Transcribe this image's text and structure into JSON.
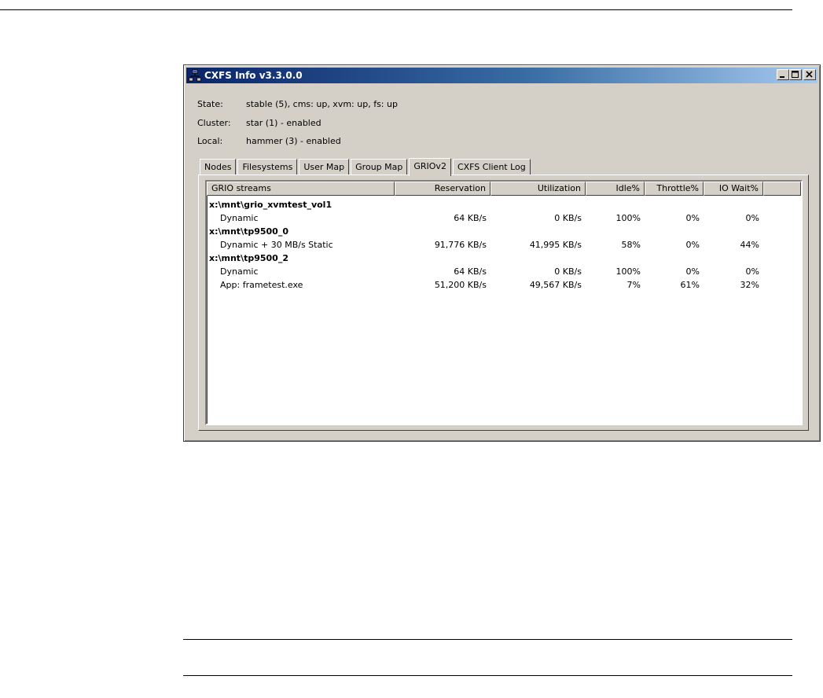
{
  "window": {
    "title": "CXFS Info v3.3.0.0"
  },
  "info": {
    "state_label": "State:",
    "state_value": "stable (5), cms: up, xvm: up, fs: up",
    "cluster_label": "Cluster:",
    "cluster_value": "star (1) - enabled",
    "local_label": "Local:",
    "local_value": "hammer (3) - enabled"
  },
  "tabs": [
    {
      "label": "Nodes"
    },
    {
      "label": "Filesystems"
    },
    {
      "label": "User Map"
    },
    {
      "label": "Group Map"
    },
    {
      "label": "GRIOv2",
      "active": true
    },
    {
      "label": "CXFS Client Log"
    }
  ],
  "table": {
    "columns": [
      "GRIO streams",
      "Reservation",
      "Utilization",
      "Idle%",
      "Throttle%",
      "IO Wait%"
    ],
    "rows": [
      {
        "type": "group",
        "name": "x:\\mnt\\grio_xvmtest_vol1"
      },
      {
        "type": "stream",
        "name": "Dynamic",
        "reservation": "64 KB/s",
        "utilization": "0 KB/s",
        "idle": "100%",
        "throttle": "0%",
        "iowait": "0%"
      },
      {
        "type": "group",
        "name": "x:\\mnt\\tp9500_0"
      },
      {
        "type": "stream",
        "name": "Dynamic + 30 MB/s Static",
        "reservation": "91,776 KB/s",
        "utilization": "41,995 KB/s",
        "idle": "58%",
        "throttle": "0%",
        "iowait": "44%"
      },
      {
        "type": "group",
        "name": "x:\\mnt\\tp9500_2"
      },
      {
        "type": "stream",
        "name": "Dynamic",
        "reservation": "64 KB/s",
        "utilization": "0 KB/s",
        "idle": "100%",
        "throttle": "0%",
        "iowait": "0%"
      },
      {
        "type": "stream",
        "name": "App: frametest.exe",
        "reservation": "51,200 KB/s",
        "utilization": "49,567 KB/s",
        "idle": "7%",
        "throttle": "61%",
        "iowait": "32%"
      }
    ]
  },
  "icons": {
    "app": "network-nodes-icon",
    "minimize": "minimize-icon",
    "maximize": "maximize-icon",
    "close": "close-icon"
  },
  "colors": {
    "titlebar_start": "#0a246a",
    "titlebar_end": "#a6caf0",
    "window_face": "#d4d0c8"
  }
}
